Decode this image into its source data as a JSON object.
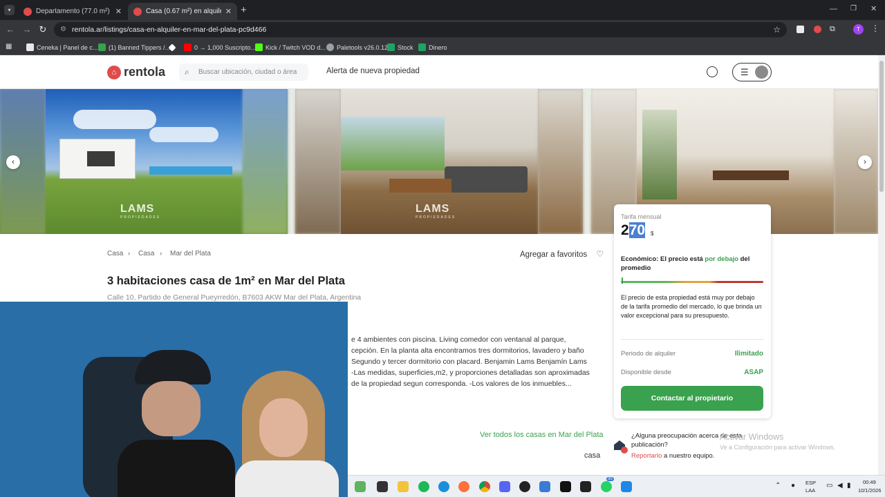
{
  "browser": {
    "tabs": [
      {
        "title": "Departamento (77.0 m²) en alqu",
        "active": false
      },
      {
        "title": "Casa (0.67 m²) en alquiler en M",
        "active": true
      }
    ],
    "new_tab": "+",
    "url": "rentola.ar/listings/casa-en-alquiler-en-mar-del-plata-pc9d466",
    "profile_initial": "T",
    "bookmarks": [
      {
        "label": "Ceneka | Panel de c...",
        "color": "#e8e8e8"
      },
      {
        "label": "(1) Banned Tippers /...",
        "color": "#3aa14e"
      },
      {
        "label": "",
        "color": "#ffffff"
      },
      {
        "label": "0 → 1,000 Suscripto...",
        "color": "#ff0000"
      },
      {
        "label": "Kick / Twitch VOD d...",
        "color": "#53fc18"
      },
      {
        "label": "Paletools v26.0.12",
        "color": "#9aa0a6"
      },
      {
        "label": "Stock",
        "color": "#1fa463"
      },
      {
        "label": "Dinero",
        "color": "#1fa463"
      }
    ]
  },
  "site": {
    "logo": "rentola",
    "search_placeholder": "Buscar ubicación, ciudad o área",
    "alert_link": "Alerta de nueva propiedad",
    "brand_color": "#e14b4b",
    "accent_color": "#3aa14e"
  },
  "gallery": {
    "watermark": "LAMS",
    "watermark_sub": "PROPIEDADES"
  },
  "breadcrumb": [
    "Casa",
    "Casa",
    "Mar del Plata"
  ],
  "favorites_label": "Agregar a favoritos",
  "listing": {
    "title": "3 habitaciones casa de 1m² en Mar del Plata",
    "address": "Calle 10, Partido de General Pueyrredón, B7603 AKW Mar del Plata, Argentina",
    "description_lines": [
      "e 4 ambientes con piscina. Living comedor con ventanal al parque,",
      "cepción. En la planta alta encontramos tres dormitorios, lavadero y baño",
      "Segundo y tercer dormitorio con placard. Benjamin Lams Benjamín Lams",
      "-Las medidas, superficies,m2, y proporciones detalladas son aproximadas",
      "de la propiedad segun corresponda. -Los valores de los inmuebles..."
    ],
    "see_all": "Ver todos los casas en Mar del Plata",
    "type_label": "casa"
  },
  "price_card": {
    "label": "Tarifa mensual",
    "price_first": "2",
    "price_selected": "70",
    "currency": "$",
    "econ_prefix": "Económico: El precio está ",
    "econ_highlight": "por debajo",
    "econ_suffix": " del promedio",
    "explanation": "El precio de esta propiedad está muy por debajo de la tarifa promedio del mercado, lo que brinda un valor excepcional para su presupuesto.",
    "period_label": "Periodo de alquiler",
    "period_value": "Ilimitado",
    "available_label": "Disponible desde",
    "available_value": "ASAP",
    "contact_button": "Contactar al propietario"
  },
  "concern": {
    "question": "¿Alguna preocupación acerca de esta publicación?",
    "report_link": "Reportarlo",
    "report_suffix": " a nuestro equipo."
  },
  "windows_watermark": {
    "title": "Activar Windows",
    "subtitle": "Ve a Configuración para activar Windows."
  },
  "taskbar": {
    "lang_top": "ESP",
    "lang_bottom": "LAA",
    "time": "00:49",
    "date": "10/1/2026",
    "badge": "30"
  }
}
